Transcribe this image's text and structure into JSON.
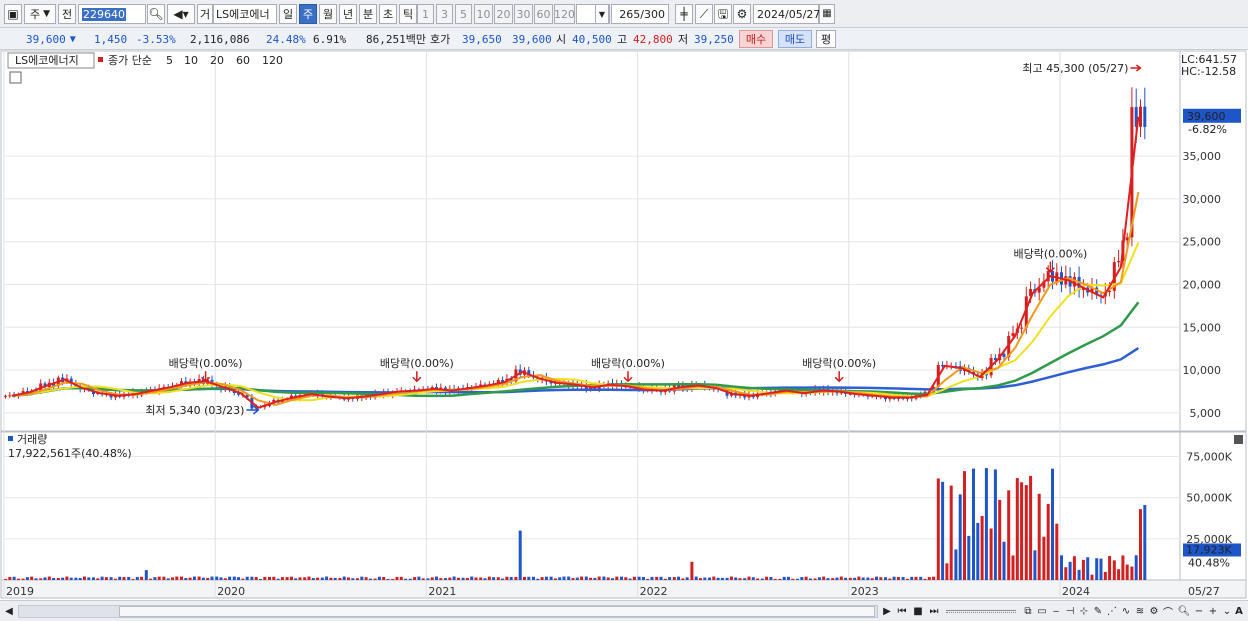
{
  "toolbar": {
    "period_dropdown": "주",
    "prev_label": "전",
    "stock_code": "229640",
    "trade_label": "거",
    "stock_name": "LS에코에너",
    "period_tabs": [
      "일",
      "주",
      "월",
      "년",
      "분",
      "초",
      "틱"
    ],
    "active_tab": "주",
    "interval_buttons": [
      "1",
      "3",
      "5",
      "10",
      "20",
      "30",
      "60",
      "120"
    ],
    "count_value": "265",
    "count_max": "/300",
    "date_value": "2024/05/27"
  },
  "quote": {
    "price": "39,600",
    "change": "1,450",
    "change_pct": "-3.53%",
    "volume": "2,116,086",
    "vol_ratio": "24.48%",
    "turnover": "6.91%",
    "amount": "86,251백만",
    "hoga_label": "호가",
    "ask": "39,650",
    "bid": "39,600",
    "open_label": "시",
    "open": "40,500",
    "high_label": "고",
    "high": "42,800",
    "low_label": "저",
    "low": "39,250",
    "buy_button": "매수",
    "sell_button": "매도",
    "eval_button": "평"
  },
  "legend": {
    "stock": "LS에코에너지",
    "type": "종가 단순",
    "ma": [
      {
        "label": "5",
        "color": "#e02020"
      },
      {
        "label": "10",
        "color": "#f09a1c"
      },
      {
        "label": "20",
        "color": "#f0e020"
      },
      {
        "label": "60",
        "color": "#2e9a4a"
      },
      {
        "label": "120",
        "color": "#2e5fd6"
      }
    ]
  },
  "right_info": {
    "lc": "LC:641.57",
    "hc": "HC:-12.58",
    "price_tag": "39,600",
    "price_pct": "-6.82%",
    "vol_tag": "17,923K",
    "vol_pct": "40.48%"
  },
  "annotations": {
    "high": "최고 45,300 (05/27)",
    "low": "최저 5,340 (03/23)",
    "dividend": "배당락(0.00%)"
  },
  "volume_panel": {
    "title": "거래량",
    "value": "17,922,561주(40.48%)"
  },
  "chart_data": {
    "type": "candlestick",
    "period": "weekly",
    "x_ticks": [
      "2019",
      "2020",
      "2021",
      "2022",
      "2023",
      "2024",
      "05/27"
    ],
    "price_ticks": [
      "5,000",
      "10,000",
      "15,000",
      "20,000",
      "25,000",
      "30,000",
      "35,000"
    ],
    "price_range": [
      3000,
      45300
    ],
    "volume_ticks": [
      "25,000K",
      "50,000K",
      "75,000K"
    ],
    "volume_range": [
      0,
      85000
    ],
    "close_series": [
      [
        "2019-01",
        7000
      ],
      [
        "2019-02",
        7400
      ],
      [
        "2019-03",
        8200
      ],
      [
        "2019-04",
        8900
      ],
      [
        "2019-05",
        7900
      ],
      [
        "2019-06",
        7300
      ],
      [
        "2019-07",
        7000
      ],
      [
        "2019-08",
        7200
      ],
      [
        "2019-09",
        7600
      ],
      [
        "2019-10",
        8000
      ],
      [
        "2019-11",
        8500
      ],
      [
        "2019-12",
        8700
      ],
      [
        "2020-01",
        8000
      ],
      [
        "2020-02",
        7300
      ],
      [
        "2020-03",
        5600
      ],
      [
        "2020-04",
        6300
      ],
      [
        "2020-05",
        6800
      ],
      [
        "2020-06",
        7200
      ],
      [
        "2020-07",
        6900
      ],
      [
        "2020-08",
        6700
      ],
      [
        "2020-09",
        6900
      ],
      [
        "2020-10",
        7200
      ],
      [
        "2020-11",
        7500
      ],
      [
        "2020-12",
        7600
      ],
      [
        "2021-01",
        7800
      ],
      [
        "2021-02",
        7600
      ],
      [
        "2021-03",
        7900
      ],
      [
        "2021-04",
        8200
      ],
      [
        "2021-05",
        8600
      ],
      [
        "2021-06",
        9800
      ],
      [
        "2021-07",
        9000
      ],
      [
        "2021-08",
        8500
      ],
      [
        "2021-09",
        8300
      ],
      [
        "2021-10",
        8000
      ],
      [
        "2021-11",
        8300
      ],
      [
        "2021-12",
        8100
      ],
      [
        "2022-01",
        7700
      ],
      [
        "2022-02",
        7600
      ],
      [
        "2022-03",
        8000
      ],
      [
        "2022-04",
        8200
      ],
      [
        "2022-05",
        7900
      ],
      [
        "2022-06",
        7200
      ],
      [
        "2022-07",
        7000
      ],
      [
        "2022-08",
        7300
      ],
      [
        "2022-09",
        7600
      ],
      [
        "2022-10",
        7300
      ],
      [
        "2022-11",
        7600
      ],
      [
        "2022-12",
        7500
      ],
      [
        "2023-01",
        7200
      ],
      [
        "2023-02",
        7000
      ],
      [
        "2023-03",
        6800
      ],
      [
        "2023-04",
        6800
      ],
      [
        "2023-05",
        7100
      ],
      [
        "2023-06",
        10500
      ],
      [
        "2023-07",
        10200
      ],
      [
        "2023-08",
        9200
      ],
      [
        "2023-09",
        11200
      ],
      [
        "2023-10",
        14000
      ],
      [
        "2023-11",
        19000
      ],
      [
        "2023-12",
        21000
      ],
      [
        "2024-01",
        20500
      ],
      [
        "2024-02",
        19500
      ],
      [
        "2024-03",
        18500
      ],
      [
        "2024-04",
        22000
      ],
      [
        "2024-05",
        39600
      ]
    ],
    "markers": {
      "high": {
        "date": "05/27",
        "value": 45300
      },
      "low": {
        "date": "03/23",
        "value": 5340
      },
      "dividend_dates": [
        "2019-12",
        "2020-12",
        "2021-12",
        "2022-12",
        "2023-12"
      ]
    },
    "moving_averages": [
      "5",
      "10",
      "20",
      "60",
      "120"
    ]
  }
}
